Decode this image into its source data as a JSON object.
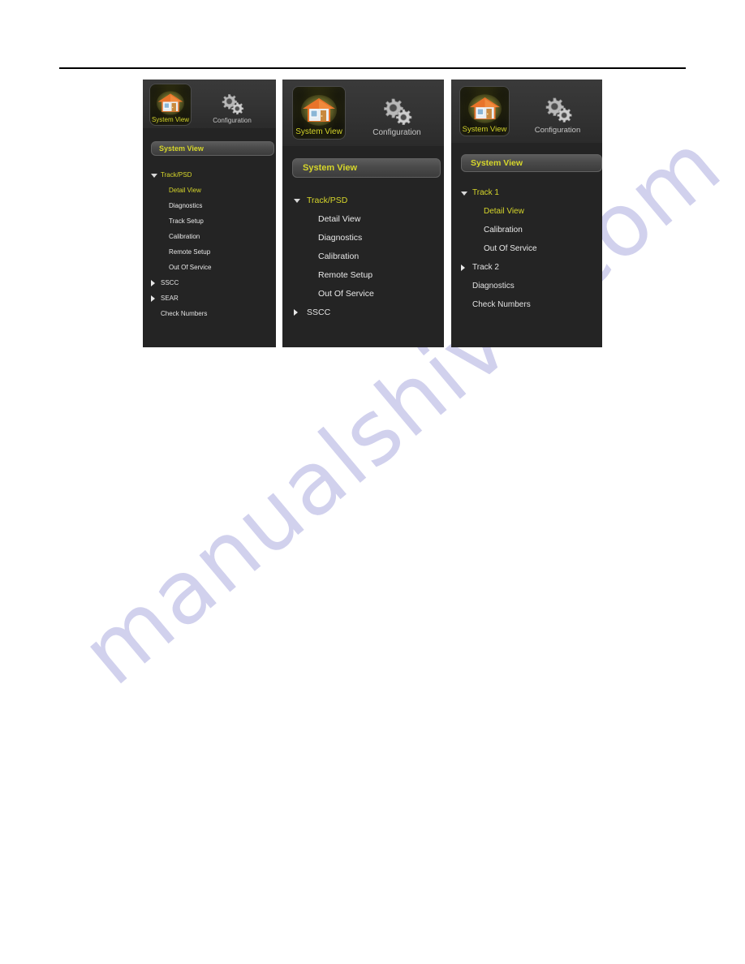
{
  "page": {
    "watermark": "manualshive.com",
    "background_color": "#ffffff",
    "rule_color": "#000000"
  },
  "colors": {
    "panel_background": "#242424",
    "header_background": "#333333",
    "accent_yellow": "#d6d62b",
    "menu_text": "#e2e2e2",
    "section_bar_top": "#5c5c5c",
    "section_bar_bottom": "#3c3c3c"
  },
  "panels": [
    {
      "id": "panel-1",
      "toolbar": [
        {
          "label": "System View",
          "icon": "house-icon",
          "state": "active"
        },
        {
          "label": "Configuration",
          "icon": "gears-icon",
          "state": "inactive"
        }
      ],
      "section_header": "System View",
      "menu": [
        {
          "label": "Track/PSD",
          "level": 0,
          "twisty": "open",
          "highlight": true
        },
        {
          "label": "Detail View",
          "level": 1,
          "twisty": "none",
          "highlight": true
        },
        {
          "label": "Diagnostics",
          "level": 1,
          "twisty": "none",
          "highlight": false
        },
        {
          "label": "Track Setup",
          "level": 1,
          "twisty": "none",
          "highlight": false
        },
        {
          "label": "Calibration",
          "level": 1,
          "twisty": "none",
          "highlight": false
        },
        {
          "label": "Remote Setup",
          "level": 1,
          "twisty": "none",
          "highlight": false
        },
        {
          "label": "Out Of Service",
          "level": 1,
          "twisty": "none",
          "highlight": false
        },
        {
          "label": "SSCC",
          "level": 0,
          "twisty": "closed",
          "highlight": false
        },
        {
          "label": "SEAR",
          "level": 0,
          "twisty": "closed",
          "highlight": false
        },
        {
          "label": "Check Numbers",
          "level": 0,
          "twisty": "none",
          "highlight": false
        }
      ]
    },
    {
      "id": "panel-2",
      "toolbar": [
        {
          "label": "System View",
          "icon": "house-icon",
          "state": "active"
        },
        {
          "label": "Configuration",
          "icon": "gears-icon",
          "state": "inactive"
        }
      ],
      "section_header": "System View",
      "menu": [
        {
          "label": "Track/PSD",
          "level": 0,
          "twisty": "open",
          "highlight": true
        },
        {
          "label": "Detail View",
          "level": 1,
          "twisty": "none",
          "highlight": false
        },
        {
          "label": "Diagnostics",
          "level": 1,
          "twisty": "none",
          "highlight": false
        },
        {
          "label": "Calibration",
          "level": 1,
          "twisty": "none",
          "highlight": false
        },
        {
          "label": "Remote Setup",
          "level": 1,
          "twisty": "none",
          "highlight": false
        },
        {
          "label": "Out Of Service",
          "level": 1,
          "twisty": "none",
          "highlight": false
        },
        {
          "label": "SSCC",
          "level": 0,
          "twisty": "closed",
          "highlight": false
        }
      ]
    },
    {
      "id": "panel-3",
      "toolbar": [
        {
          "label": "System View",
          "icon": "house-icon",
          "state": "active"
        },
        {
          "label": "Configuration",
          "icon": "gears-icon",
          "state": "inactive"
        }
      ],
      "section_header": "System View",
      "menu": [
        {
          "label": "Track 1",
          "level": 0,
          "twisty": "open",
          "highlight": true
        },
        {
          "label": "Detail View",
          "level": 1,
          "twisty": "none",
          "highlight": true
        },
        {
          "label": "Calibration",
          "level": 1,
          "twisty": "none",
          "highlight": false
        },
        {
          "label": "Out Of Service",
          "level": 1,
          "twisty": "none",
          "highlight": false
        },
        {
          "label": "Track 2",
          "level": 0,
          "twisty": "closed",
          "highlight": false
        },
        {
          "label": "Diagnostics",
          "level": 0,
          "twisty": "none",
          "highlight": false
        },
        {
          "label": "Check Numbers",
          "level": 0,
          "twisty": "none",
          "highlight": false
        }
      ]
    }
  ]
}
